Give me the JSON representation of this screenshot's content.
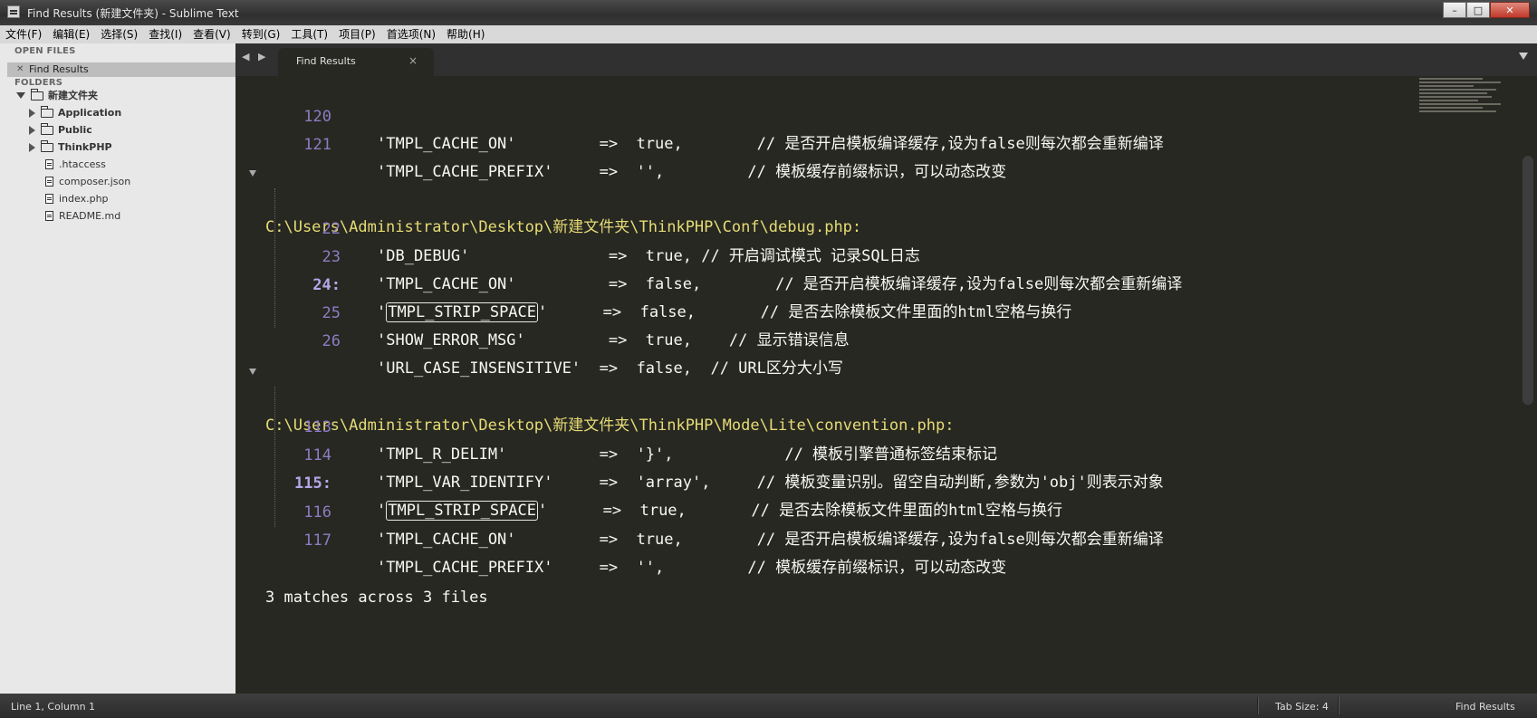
{
  "window": {
    "title": "Find Results (新建文件夹) - Sublime Text",
    "minimize": "–",
    "maximize": "□",
    "close": "✕"
  },
  "menu": [
    "文件(F)",
    "编辑(E)",
    "选择(S)",
    "查找(I)",
    "查看(V)",
    "转到(G)",
    "工具(T)",
    "项目(P)",
    "首选项(N)",
    "帮助(H)"
  ],
  "sidebar": {
    "open_files_header": "OPEN FILES",
    "open_file": "Find Results",
    "folders_header": "FOLDERS",
    "root_folder": "新建文件夹",
    "folders": [
      "Application",
      "Public",
      "ThinkPHP"
    ],
    "files": [
      ".htaccess",
      "composer.json",
      "index.php",
      "README.md"
    ]
  },
  "tabs": {
    "nav": "◀ ▶",
    "active": "Find Results",
    "close": "×"
  },
  "editor": {
    "lines": [
      {
        "ln": "120",
        "code": "'TMPL_CACHE_ON'         =>  true,        // 是否开启模板编译缓存,设为false则每次都会重新编译"
      },
      {
        "ln": "121",
        "code": "'TMPL_CACHE_PREFIX'     =>  '',         // 模板缓存前缀标识，可以动态改变"
      },
      {
        "path": "C:\\Users\\Administrator\\Desktop\\新建文件夹\\ThinkPHP\\Conf\\debug.php:"
      },
      {
        "ln": "22",
        "code": "'DB_DEBUG'               =>  true, // 开启调试模式 记录SQL日志"
      },
      {
        "ln": "23",
        "code": "'TMPL_CACHE_ON'          =>  false,        // 是否开启模板编译缓存,设为false则每次都会重新编译"
      },
      {
        "ln": "24:",
        "pre": "'",
        "match": "TMPL_STRIP_SPACE",
        "post": "'      =>  false,       // 是否去除模板文件里面的html空格与换行"
      },
      {
        "ln": "25",
        "code": "'SHOW_ERROR_MSG'         =>  true,    // 显示错误信息"
      },
      {
        "ln": "26",
        "code": "'URL_CASE_INSENSITIVE'  =>  false,  // URL区分大小写"
      },
      {
        "path": "C:\\Users\\Administrator\\Desktop\\新建文件夹\\ThinkPHP\\Mode\\Lite\\convention.php:"
      },
      {
        "ln": "113",
        "code": "'TMPL_R_DELIM'          =>  '}',            // 模板引擎普通标签结束标记"
      },
      {
        "ln": "114",
        "code": "'TMPL_VAR_IDENTIFY'     =>  'array',     // 模板变量识别。留空自动判断,参数为'obj'则表示对象"
      },
      {
        "ln": "115:",
        "pre": "'",
        "match": "TMPL_STRIP_SPACE",
        "post": "'      =>  true,       // 是否去除模板文件里面的html空格与换行"
      },
      {
        "ln": "116",
        "code": "'TMPL_CACHE_ON'         =>  true,        // 是否开启模板编译缓存,设为false则每次都会重新编译"
      },
      {
        "ln": "117",
        "code": "'TMPL_CACHE_PREFIX'     =>  '',         // 模板缓存前缀标识，可以动态改变"
      }
    ],
    "summary": "3 matches across 3 files"
  },
  "status": {
    "position": "Line 1, Column 1",
    "tab_size": "Tab Size: 4",
    "syntax": "Find Results"
  }
}
